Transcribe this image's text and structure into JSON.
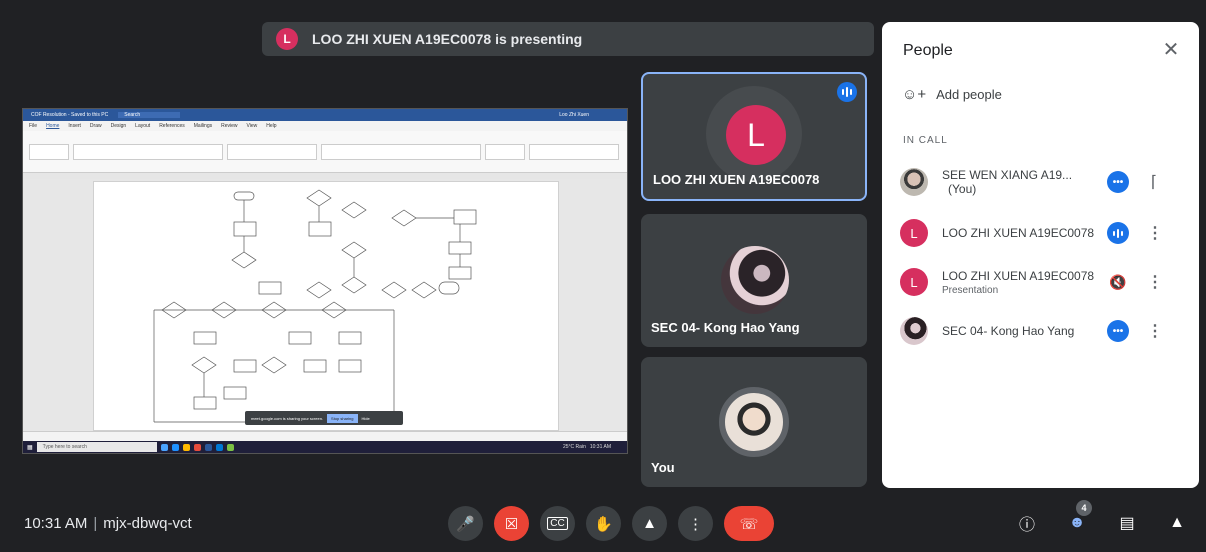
{
  "banner": {
    "avatar_letter": "L",
    "text": "LOO ZHI XUEN A19EC0078 is presenting"
  },
  "shared_screen": {
    "title_bar": "COF Resolution - Saved to this PC",
    "search": "Search",
    "user": "Loo Zhi Xuen",
    "menu": [
      "File",
      "Home",
      "Insert",
      "Draw",
      "Design",
      "Layout",
      "References",
      "Mailings",
      "Review",
      "View",
      "Help"
    ],
    "share_notice": "meet.google.com is sharing your screen.",
    "stop_sharing": "Stop sharing",
    "hide": "Hide",
    "taskbar_search": "Type here to search",
    "weather": "25°C Rain",
    "clock": "10:31 AM"
  },
  "tiles": [
    {
      "name": "LOO ZHI XUEN A19EC0078",
      "avatar_letter": "L",
      "speaking": true
    },
    {
      "name": "SEC 04- Kong Hao Yang"
    },
    {
      "name": "You"
    }
  ],
  "panel": {
    "title": "People",
    "add_people": "Add people",
    "in_call_label": "IN CALL",
    "participants": [
      {
        "name": "SEE WEN XIANG A19...",
        "you": "(You)",
        "status": "more",
        "action": "pin-icon"
      },
      {
        "name": "LOO ZHI XUEN A19EC0078",
        "avatar_letter": "L",
        "status": "speaking",
        "action": "more"
      },
      {
        "name": "LOO ZHI XUEN A19EC0078",
        "sub": "Presentation",
        "avatar_letter": "L",
        "status": "muted",
        "action": "more"
      },
      {
        "name": "SEC 04- Kong Hao Yang",
        "status": "more",
        "action": "more"
      }
    ]
  },
  "bottom_bar": {
    "time": "10:31 AM",
    "separator": "|",
    "meeting_code": "mjx-dbwq-vct",
    "people_count": "4"
  },
  "colors": {
    "accent": "#1a73e8",
    "avatar": "#d62f5f",
    "end_call": "#ea4335",
    "background": "#202124"
  }
}
